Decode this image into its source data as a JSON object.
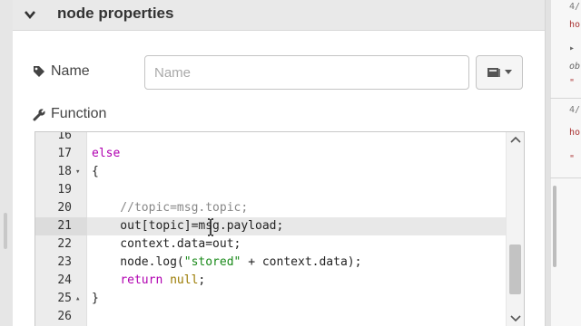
{
  "section": {
    "title": "node properties"
  },
  "name_field": {
    "label": "Name",
    "placeholder": "Name",
    "value": ""
  },
  "function_field": {
    "label": "Function"
  },
  "editor": {
    "lines": [
      {
        "num": "16",
        "fold": "",
        "segments": []
      },
      {
        "num": "17",
        "fold": "",
        "segments": [
          {
            "t": "else",
            "c": "kw"
          }
        ]
      },
      {
        "num": "18",
        "fold": "▾",
        "segments": [
          {
            "t": "{",
            "c": ""
          }
        ]
      },
      {
        "num": "19",
        "fold": "",
        "segments": []
      },
      {
        "num": "20",
        "fold": "",
        "segments": [
          {
            "t": "    //topic=msg.topic;",
            "c": "cm"
          }
        ]
      },
      {
        "num": "21",
        "fold": "",
        "active": true,
        "segments": [
          {
            "t": "    out[topic]=msg.payload;",
            "c": ""
          }
        ]
      },
      {
        "num": "22",
        "fold": "",
        "segments": [
          {
            "t": "    context.data=out;",
            "c": ""
          }
        ]
      },
      {
        "num": "23",
        "fold": "",
        "segments": [
          {
            "t": "    node.log(",
            "c": ""
          },
          {
            "t": "\"stored\"",
            "c": "str"
          },
          {
            "t": " + context.data);",
            "c": ""
          }
        ]
      },
      {
        "num": "24",
        "fold": "",
        "segments": [
          {
            "t": "    ",
            "c": ""
          },
          {
            "t": "return",
            "c": "kw"
          },
          {
            "t": " ",
            "c": ""
          },
          {
            "t": "null",
            "c": "lit"
          },
          {
            "t": ";",
            "c": ""
          }
        ]
      },
      {
        "num": "25",
        "fold": "▴",
        "segments": [
          {
            "t": "}",
            "c": ""
          }
        ]
      },
      {
        "num": "26",
        "fold": "",
        "segments": []
      }
    ]
  },
  "right_panel": {
    "fragments": [
      {
        "text": "4/",
        "kind": "date"
      },
      {
        "text": "ho",
        "kind": "topic"
      },
      {
        "text": "▸",
        "kind": "note"
      },
      {
        "text": "ob",
        "kind": "note"
      },
      {
        "text": "\"",
        "kind": "topic"
      },
      {
        "text": "4/",
        "kind": "date"
      },
      {
        "text": "ho",
        "kind": "topic"
      },
      {
        "text": "\"",
        "kind": "topic"
      }
    ]
  },
  "icons": [
    "chevron-down-icon",
    "tag-icon",
    "book-icon",
    "caret-down-icon",
    "wrench-icon",
    "arrow-up-icon",
    "arrow-down-icon",
    "text-cursor-icon"
  ]
}
